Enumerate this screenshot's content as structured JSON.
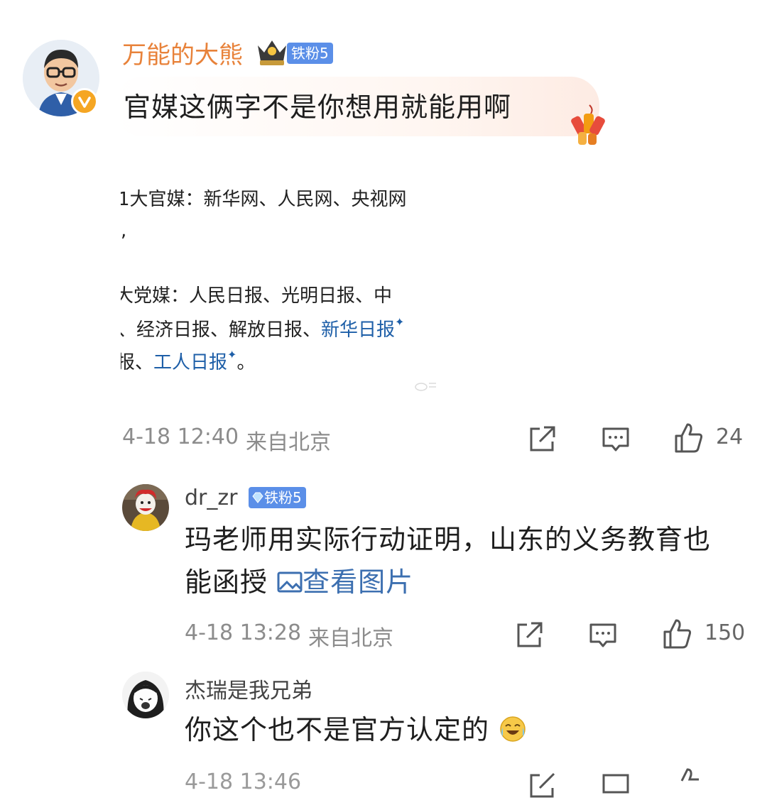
{
  "colors": {
    "username_accent": "#e8823a",
    "badge_bg": "#5b8fe8",
    "link": "#1e5fa8",
    "meta_gray": "#8c8c8c"
  },
  "main_comment": {
    "username": "万能的大熊",
    "fan_badge": "铁粉5",
    "text": "官媒这俩字不是你想用就能用啊",
    "embed_lines": [
      "1大官媒：新华网、人民网、央视网",
      ",",
      "大党媒：人民日报、光明日报、中",
      "、经济日报、解放日报、",
      "新华日报",
      "报、",
      "工人日报",
      "。"
    ],
    "timestamp": "4-18 12:40",
    "location": "来自北京",
    "like_count": "24"
  },
  "replies": [
    {
      "username": "dr_zr",
      "fan_badge": "铁粉5",
      "text_line1": "玛老师用实际行动证明，山东的义务教育也",
      "text_line2": "能函授",
      "view_image": "查看图片",
      "timestamp": "4-18 13:28",
      "location": "来自北京",
      "like_count": "150"
    },
    {
      "username": "杰瑞是我兄弟",
      "text": "你这个也不是官方认定的"
    }
  ],
  "icons": [
    "share-icon",
    "comment-icon",
    "like-icon",
    "image-icon",
    "crown-icon",
    "verified-icon",
    "firecracker-icon",
    "laugh-cry-emoji-icon"
  ]
}
